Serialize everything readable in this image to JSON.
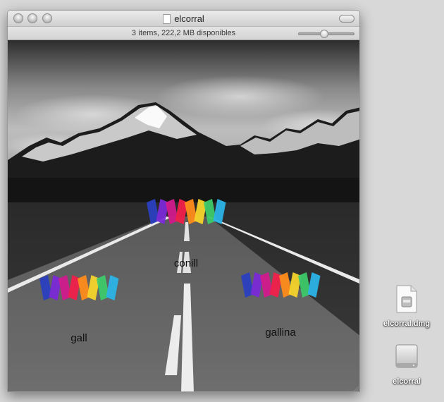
{
  "window": {
    "title": "elcorral",
    "status": "3 ítems, 222,2 MB disponibles",
    "icon_size_fraction": 0.45
  },
  "items": [
    {
      "name": "conill",
      "icon": "colorful-zigzag-logo-icon"
    },
    {
      "name": "gall",
      "icon": "colorful-zigzag-logo-icon"
    },
    {
      "name": "gallina",
      "icon": "colorful-zigzag-logo-icon"
    }
  ],
  "desktop": [
    {
      "name": "elcorral.dmg",
      "icon": "disk-image-file-icon"
    },
    {
      "name": "elcorral",
      "icon": "mounted-drive-icon"
    }
  ],
  "colors": {
    "desktop_bg": "#d8d8d8",
    "logo": [
      "#2a3fbf",
      "#7a2ad6",
      "#d21a8c",
      "#f0204a",
      "#ff8c1a",
      "#f6d32b",
      "#3ec96a",
      "#2bb3e6"
    ]
  }
}
